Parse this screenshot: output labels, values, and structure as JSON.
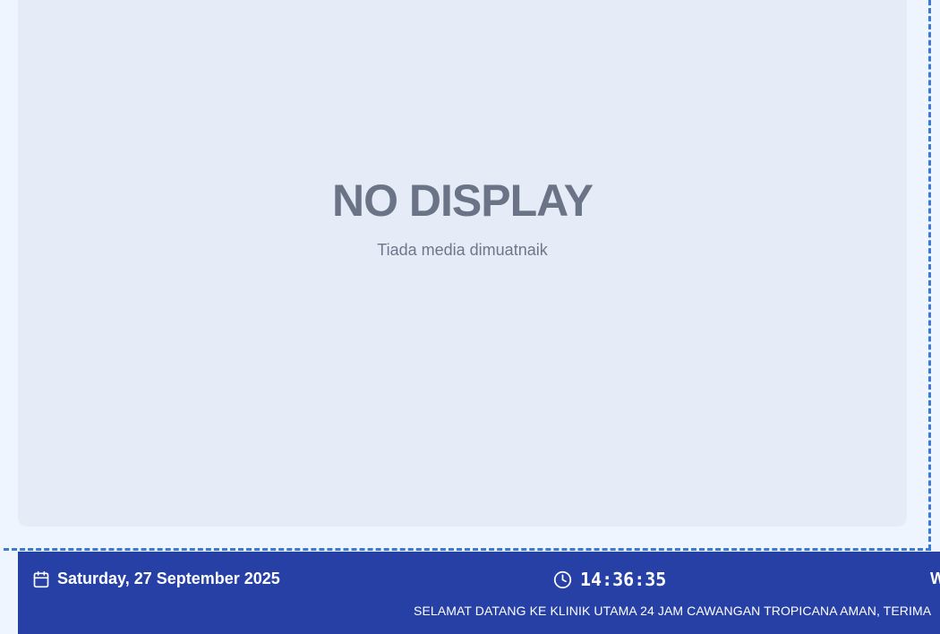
{
  "media": {
    "title": "NO DISPLAY",
    "subtitle": "Tiada media dimuatnaik"
  },
  "footer": {
    "date": "Saturday, 27 September 2025",
    "time": "14:36:35",
    "edge_text": "W",
    "ticker": "SELAMAT DATANG KE KLINIK UTAMA 24 JAM CAWANGAN TROPICANA AMAN, TERIMA",
    "icons": {
      "date": "calendar-icon",
      "time": "clock-icon"
    }
  },
  "colors": {
    "background": "#eff5fe",
    "panel": "#e6ecf7",
    "title_text": "#6b7487",
    "footer": "#2740a6",
    "dashed_border": "#3b7bd6"
  }
}
